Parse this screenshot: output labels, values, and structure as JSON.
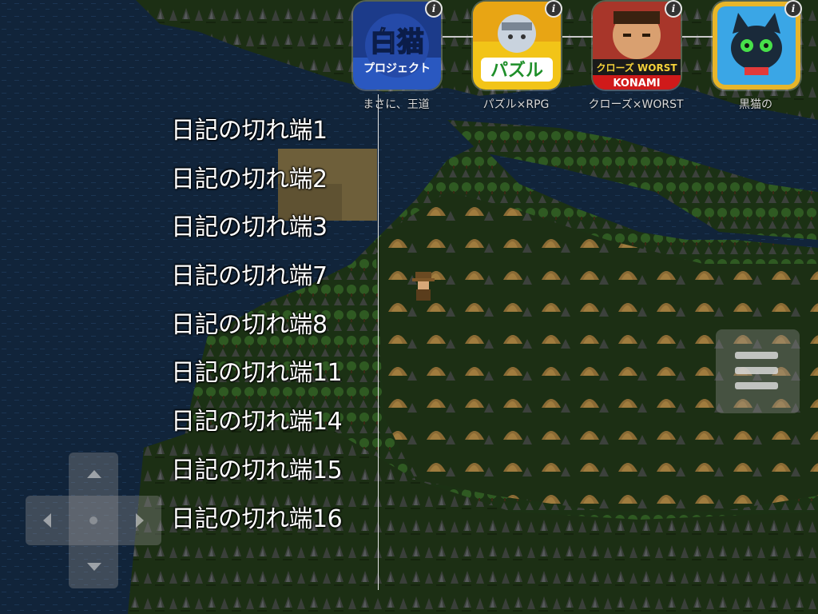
{
  "ad_banner": {
    "apps": [
      {
        "caption": "まさに、王道",
        "icon": "shironeko-project-app-icon",
        "icon_text_main": "白猫",
        "icon_text_sub": "プロジェクト",
        "accent": "#3a6fd8"
      },
      {
        "caption": "パズル×RPG",
        "icon": "puzzle-rpg-app-icon",
        "icon_text_main": "パズル",
        "accent": "#f2c418"
      },
      {
        "caption": "クローズ×WORST",
        "icon": "crows-worst-app-icon",
        "icon_text_main": "クローズ WORST",
        "icon_text_sub": "KONAMI",
        "accent": "#b51c1c"
      },
      {
        "caption": "黒猫の",
        "icon": "black-cat-app-icon",
        "accent": "#2ea0e0"
      }
    ],
    "info_symbol": "i"
  },
  "diary_list": {
    "items": [
      "日記の切れ端1",
      "日記の切れ端2",
      "日記の切れ端3",
      "日記の切れ端7",
      "日記の切れ端8",
      "日記の切れ端11",
      "日記の切れ端14",
      "日記の切れ端15",
      "日記の切れ端16"
    ]
  },
  "controls": {
    "menu_icon": "hamburger-menu-icon",
    "dpad_icon": "dpad-icon"
  },
  "colors": {
    "sea": "#10233a",
    "grass": "#1f3316",
    "sand": "#6e5f3a",
    "text": "#ffffff"
  }
}
